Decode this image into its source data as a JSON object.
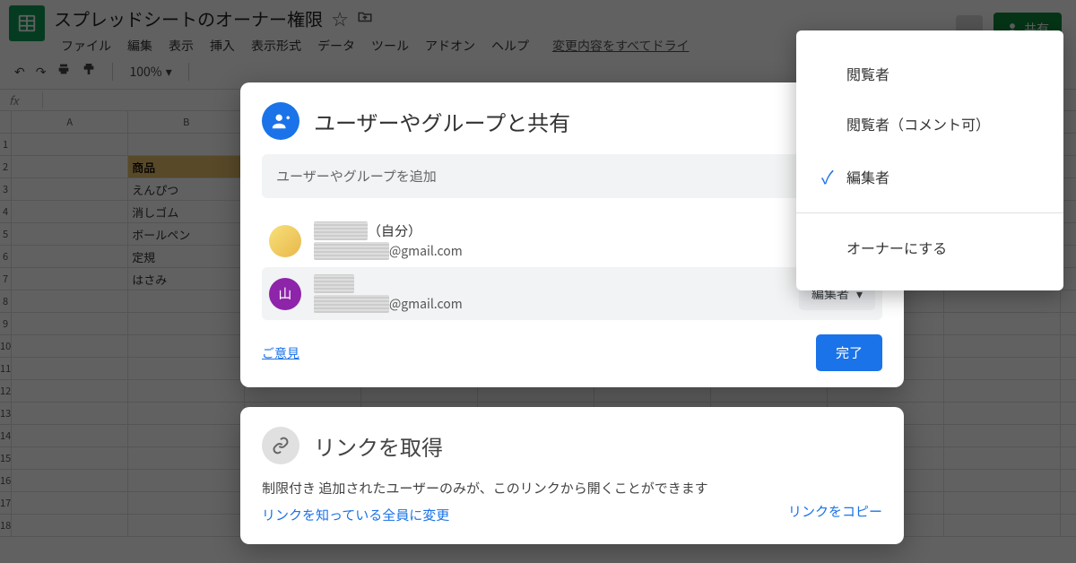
{
  "doc": {
    "title": "スプレッドシートのオーナー権限"
  },
  "menubar": {
    "items": [
      "ファイル",
      "編集",
      "表示",
      "挿入",
      "表示形式",
      "データ",
      "ツール",
      "アドオン",
      "ヘルプ"
    ],
    "drive_msg": "変更内容をすべてドライ"
  },
  "toolbar": {
    "zoom": "100%"
  },
  "header": {
    "share_label": "共有"
  },
  "formula_bar": {
    "fx": "fx"
  },
  "grid": {
    "cols": [
      "A",
      "B"
    ],
    "rows_count": 18,
    "b_header_row": 2,
    "b_header": "商品",
    "b_values": [
      "えんぴつ",
      "消しゴム",
      "ボールペン",
      "定規",
      "はさみ"
    ]
  },
  "share_dialog": {
    "title": "ユーザーやグループと共有",
    "input_placeholder": "ユーザーやグループを追加",
    "owner": {
      "name_hidden": "●●●●",
      "suffix": "（自分）",
      "email_hidden": "●●●●●●",
      "email_domain": "@gmail.com"
    },
    "user2": {
      "name_hidden": "●●●",
      "avatar_text": "山",
      "email_hidden": "●●●●●●",
      "email_domain": "@gmail.com",
      "role_label": "編集者"
    },
    "feedback": "ご意見",
    "done": "完了"
  },
  "link_card": {
    "title": "リンクを取得",
    "desc": "制限付き 追加されたユーザーのみが、このリンクから開くことができます",
    "change": "リンクを知っている全員に変更",
    "copy": "リンクをコピー"
  },
  "role_menu": {
    "items": [
      {
        "label": "閲覧者",
        "selected": false
      },
      {
        "label": "閲覧者（コメント可）",
        "selected": false
      },
      {
        "label": "編集者",
        "selected": true
      }
    ],
    "owner_action": "オーナーにする"
  }
}
